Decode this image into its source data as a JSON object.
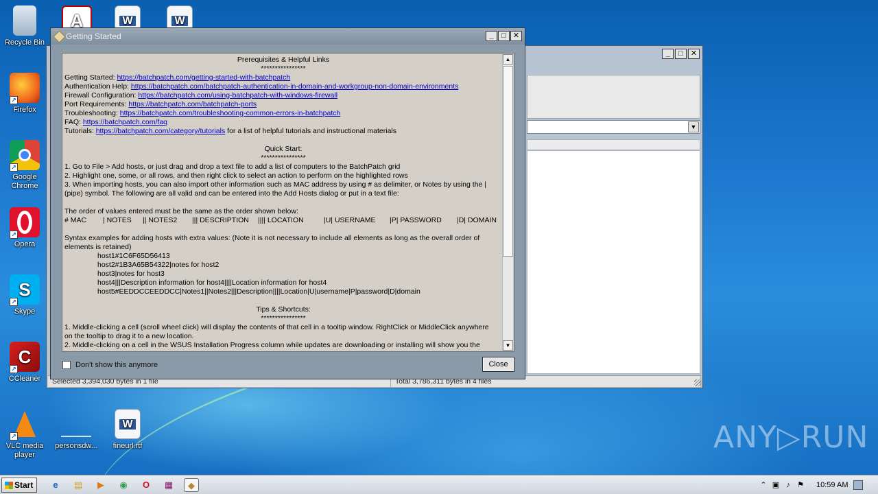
{
  "desktop": {
    "icons": [
      {
        "label": "Recycle Bin",
        "icon": "recycle-bin-icon"
      },
      {
        "label": "Firefox",
        "icon": "firefox-icon"
      },
      {
        "label": "Google Chrome",
        "icon": "chrome-icon"
      },
      {
        "label": "Opera",
        "icon": "opera-icon"
      },
      {
        "label": "Skype",
        "icon": "skype-icon"
      },
      {
        "label": "CCleaner",
        "icon": "ccleaner-icon"
      },
      {
        "label": "VLC media player",
        "icon": "vlc-icon"
      },
      {
        "label": "personsdw...",
        "icon": "file-icon"
      },
      {
        "label": "fineurl.rtf",
        "icon": "word-document-icon"
      }
    ],
    "top_icons": [
      "pdf-document-icon",
      "word-document-icon",
      "word-document-icon"
    ]
  },
  "background_window": {
    "status_left": "Selected 3,394,030 bytes in 1 file",
    "status_right": "Total 3,786,311 bytes in 4 files"
  },
  "dialog": {
    "title": "Getting Started",
    "sections": {
      "prereq_heading": "Prerequisites & Helpful Links",
      "stars": "****************",
      "links": [
        {
          "label": "Getting Started: ",
          "url": "https://batchpatch.com/getting-started-with-batchpatch",
          "suffix": ""
        },
        {
          "label": "Authentication Help: ",
          "url": "https://batchpatch.com/batchpatch-authentication-in-domain-and-workgroup-non-domain-environments",
          "suffix": ""
        },
        {
          "label": "Firewall Configuration: ",
          "url": "https://batchpatch.com/using-batchpatch-with-windows-firewall",
          "suffix": ""
        },
        {
          "label": "Port Requirements: ",
          "url": "https://batchpatch.com/batchpatch-ports",
          "suffix": ""
        },
        {
          "label": "Troubleshooting: ",
          "url": "https://batchpatch.com/troubleshooting-common-errors-in-batchpatch",
          "suffix": ""
        },
        {
          "label": "FAQ: ",
          "url": "https://batchpatch.com/faq",
          "suffix": ""
        },
        {
          "label": "Tutorials: ",
          "url": "https://batchpatch.com/category/tutorials",
          "suffix": " for a list of helpful tutorials and instructional materials"
        }
      ],
      "quick_heading": "Quick Start:",
      "quick_steps": [
        "1.  Go to File > Add hosts, or just drag and drop a text file to add a list of computers to the BatchPatch grid",
        "2.  Highlight one, some, or all rows, and then right click to select an action to perform on the highlighted rows",
        "3.  When importing hosts, you can also import other information such as MAC address by using # as delimiter, or Notes by using the |",
        "(pipe) symbol.  The following are all valid and can be entered into the Add Hosts dialog or put in a text file:"
      ],
      "order_note": "The order of values entered must be the same as the order shown below:",
      "order_cols": [
        "# MAC",
        "| NOTES",
        "|| NOTES2",
        "||| DESCRIPTION",
        "|||| LOCATION",
        "|U| USERNAME",
        "|P| PASSWORD",
        "|D| DOMAIN"
      ],
      "syntax_note_1": "Syntax examples for adding hosts with extra values:  (Note it is not necessary to include all elements as long as the overall order of",
      "syntax_note_2": "elements is retained)",
      "examples": [
        "host1#1C6F65D56413",
        "host2#1B3A65B54322|notes for host2",
        "host3|notes for host3",
        "host4|||Description information for host4||||Location information for host4",
        "host5#EEDDCCEEDDCC|Notes1||Notes2|||Description||||Location|U|username|P|password|D|domain"
      ],
      "tips_heading": "Tips & Shortcuts:",
      "tips": [
        "1.  Middle-clicking a cell (scroll wheel click) will display the contents of that cell in a tooltip window.  RightClick or MiddleClick anywhere",
        "on the tooltip to drag it to a new location.",
        "2.  Middle-clicking on a cell in the WSUS Installation Progress column while updates are downloading or installing will show you the"
      ]
    },
    "checkbox_label": "Don't show this anymore",
    "close_label": "Close"
  },
  "watermark": "ANY▷RUN",
  "taskbar": {
    "start_label": "Start",
    "clock": "10:59 AM"
  }
}
